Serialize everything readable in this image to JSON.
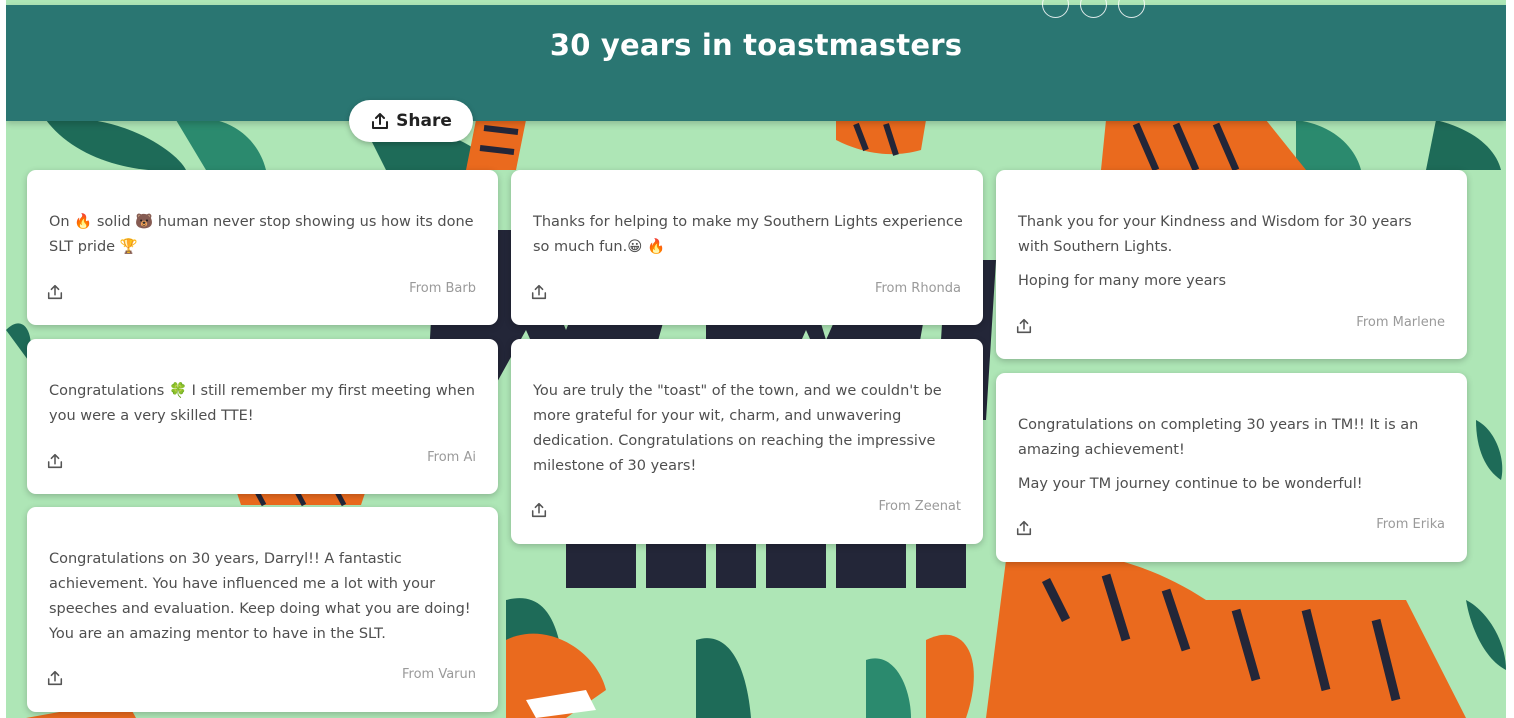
{
  "header": {
    "title": "30 years in toastmasters"
  },
  "toolbar": {
    "share_label": "Share",
    "share_icon": "share-upload-icon"
  },
  "cards": [
    {
      "paragraphs": [
        "On 🔥 solid 🐻 human never stop showing us how its done SLT pride 🏆"
      ],
      "from": "From Barb"
    },
    {
      "paragraphs": [
        "Congratulations 🍀  I still remember my first meeting when you were a very skilled TTE!"
      ],
      "from": "From Ai"
    },
    {
      "paragraphs": [
        "Congratulations on 30 years, Darryl!! A fantastic achievement. You have influenced me a lot with your speeches and evaluation. Keep doing what you are doing! You are an amazing mentor to have in the SLT."
      ],
      "from": "From Varun"
    },
    {
      "paragraphs": [
        "Thanks for helping to make my Southern Lights experience so much fun.😀 🔥"
      ],
      "from": "From Rhonda"
    },
    {
      "paragraphs": [
        "You are truly the \"toast\" of the town, and we couldn't be more grateful for your wit, charm, and unwavering dedication. Congratulations on reaching the impressive milestone of 30 years!"
      ],
      "from": "From Zeenat"
    },
    {
      "paragraphs": [
        "Thank you for your Kindness and Wisdom for 30 years with Southern Lights.",
        "Hoping for many more years"
      ],
      "from": "From Marlene"
    },
    {
      "paragraphs": [
        "Congratulations on completing 30 years in TM!! It is an amazing achievement!",
        "May your TM journey continue to be wonderful!"
      ],
      "from": "From Erika"
    }
  ],
  "theme": {
    "header_color": "#2a7672",
    "background_color": "#aee6b6",
    "tiger_orange": "#ea6a1e",
    "leaf_dark": "#1e6b58"
  }
}
